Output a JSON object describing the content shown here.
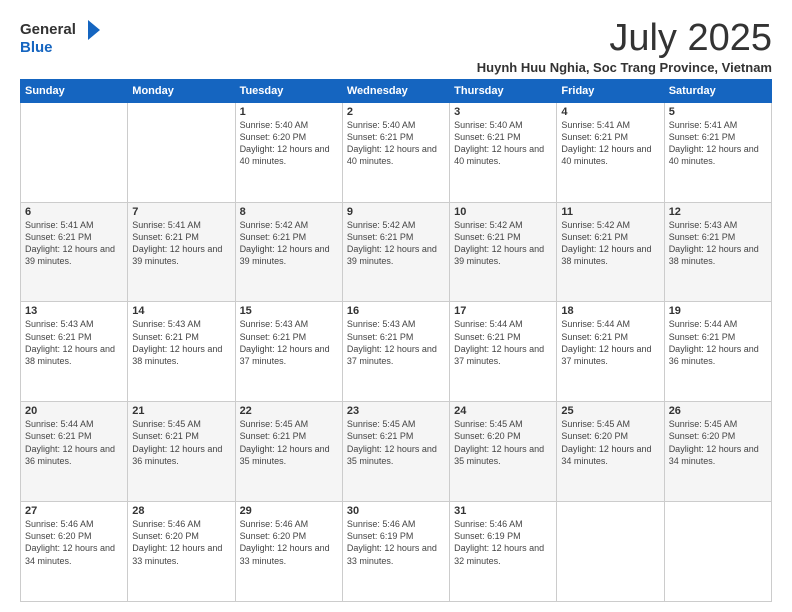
{
  "header": {
    "logo_general": "General",
    "logo_blue": "Blue",
    "month_title": "July 2025",
    "location": "Huynh Huu Nghia, Soc Trang Province, Vietnam"
  },
  "weekdays": [
    "Sunday",
    "Monday",
    "Tuesday",
    "Wednesday",
    "Thursday",
    "Friday",
    "Saturday"
  ],
  "weeks": [
    [
      {
        "day": "",
        "info": ""
      },
      {
        "day": "",
        "info": ""
      },
      {
        "day": "1",
        "info": "Sunrise: 5:40 AM\nSunset: 6:20 PM\nDaylight: 12 hours and 40 minutes."
      },
      {
        "day": "2",
        "info": "Sunrise: 5:40 AM\nSunset: 6:21 PM\nDaylight: 12 hours and 40 minutes."
      },
      {
        "day": "3",
        "info": "Sunrise: 5:40 AM\nSunset: 6:21 PM\nDaylight: 12 hours and 40 minutes."
      },
      {
        "day": "4",
        "info": "Sunrise: 5:41 AM\nSunset: 6:21 PM\nDaylight: 12 hours and 40 minutes."
      },
      {
        "day": "5",
        "info": "Sunrise: 5:41 AM\nSunset: 6:21 PM\nDaylight: 12 hours and 40 minutes."
      }
    ],
    [
      {
        "day": "6",
        "info": "Sunrise: 5:41 AM\nSunset: 6:21 PM\nDaylight: 12 hours and 39 minutes."
      },
      {
        "day": "7",
        "info": "Sunrise: 5:41 AM\nSunset: 6:21 PM\nDaylight: 12 hours and 39 minutes."
      },
      {
        "day": "8",
        "info": "Sunrise: 5:42 AM\nSunset: 6:21 PM\nDaylight: 12 hours and 39 minutes."
      },
      {
        "day": "9",
        "info": "Sunrise: 5:42 AM\nSunset: 6:21 PM\nDaylight: 12 hours and 39 minutes."
      },
      {
        "day": "10",
        "info": "Sunrise: 5:42 AM\nSunset: 6:21 PM\nDaylight: 12 hours and 39 minutes."
      },
      {
        "day": "11",
        "info": "Sunrise: 5:42 AM\nSunset: 6:21 PM\nDaylight: 12 hours and 38 minutes."
      },
      {
        "day": "12",
        "info": "Sunrise: 5:43 AM\nSunset: 6:21 PM\nDaylight: 12 hours and 38 minutes."
      }
    ],
    [
      {
        "day": "13",
        "info": "Sunrise: 5:43 AM\nSunset: 6:21 PM\nDaylight: 12 hours and 38 minutes."
      },
      {
        "day": "14",
        "info": "Sunrise: 5:43 AM\nSunset: 6:21 PM\nDaylight: 12 hours and 38 minutes."
      },
      {
        "day": "15",
        "info": "Sunrise: 5:43 AM\nSunset: 6:21 PM\nDaylight: 12 hours and 37 minutes."
      },
      {
        "day": "16",
        "info": "Sunrise: 5:43 AM\nSunset: 6:21 PM\nDaylight: 12 hours and 37 minutes."
      },
      {
        "day": "17",
        "info": "Sunrise: 5:44 AM\nSunset: 6:21 PM\nDaylight: 12 hours and 37 minutes."
      },
      {
        "day": "18",
        "info": "Sunrise: 5:44 AM\nSunset: 6:21 PM\nDaylight: 12 hours and 37 minutes."
      },
      {
        "day": "19",
        "info": "Sunrise: 5:44 AM\nSunset: 6:21 PM\nDaylight: 12 hours and 36 minutes."
      }
    ],
    [
      {
        "day": "20",
        "info": "Sunrise: 5:44 AM\nSunset: 6:21 PM\nDaylight: 12 hours and 36 minutes."
      },
      {
        "day": "21",
        "info": "Sunrise: 5:45 AM\nSunset: 6:21 PM\nDaylight: 12 hours and 36 minutes."
      },
      {
        "day": "22",
        "info": "Sunrise: 5:45 AM\nSunset: 6:21 PM\nDaylight: 12 hours and 35 minutes."
      },
      {
        "day": "23",
        "info": "Sunrise: 5:45 AM\nSunset: 6:21 PM\nDaylight: 12 hours and 35 minutes."
      },
      {
        "day": "24",
        "info": "Sunrise: 5:45 AM\nSunset: 6:20 PM\nDaylight: 12 hours and 35 minutes."
      },
      {
        "day": "25",
        "info": "Sunrise: 5:45 AM\nSunset: 6:20 PM\nDaylight: 12 hours and 34 minutes."
      },
      {
        "day": "26",
        "info": "Sunrise: 5:45 AM\nSunset: 6:20 PM\nDaylight: 12 hours and 34 minutes."
      }
    ],
    [
      {
        "day": "27",
        "info": "Sunrise: 5:46 AM\nSunset: 6:20 PM\nDaylight: 12 hours and 34 minutes."
      },
      {
        "day": "28",
        "info": "Sunrise: 5:46 AM\nSunset: 6:20 PM\nDaylight: 12 hours and 33 minutes."
      },
      {
        "day": "29",
        "info": "Sunrise: 5:46 AM\nSunset: 6:20 PM\nDaylight: 12 hours and 33 minutes."
      },
      {
        "day": "30",
        "info": "Sunrise: 5:46 AM\nSunset: 6:19 PM\nDaylight: 12 hours and 33 minutes."
      },
      {
        "day": "31",
        "info": "Sunrise: 5:46 AM\nSunset: 6:19 PM\nDaylight: 12 hours and 32 minutes."
      },
      {
        "day": "",
        "info": ""
      },
      {
        "day": "",
        "info": ""
      }
    ]
  ]
}
